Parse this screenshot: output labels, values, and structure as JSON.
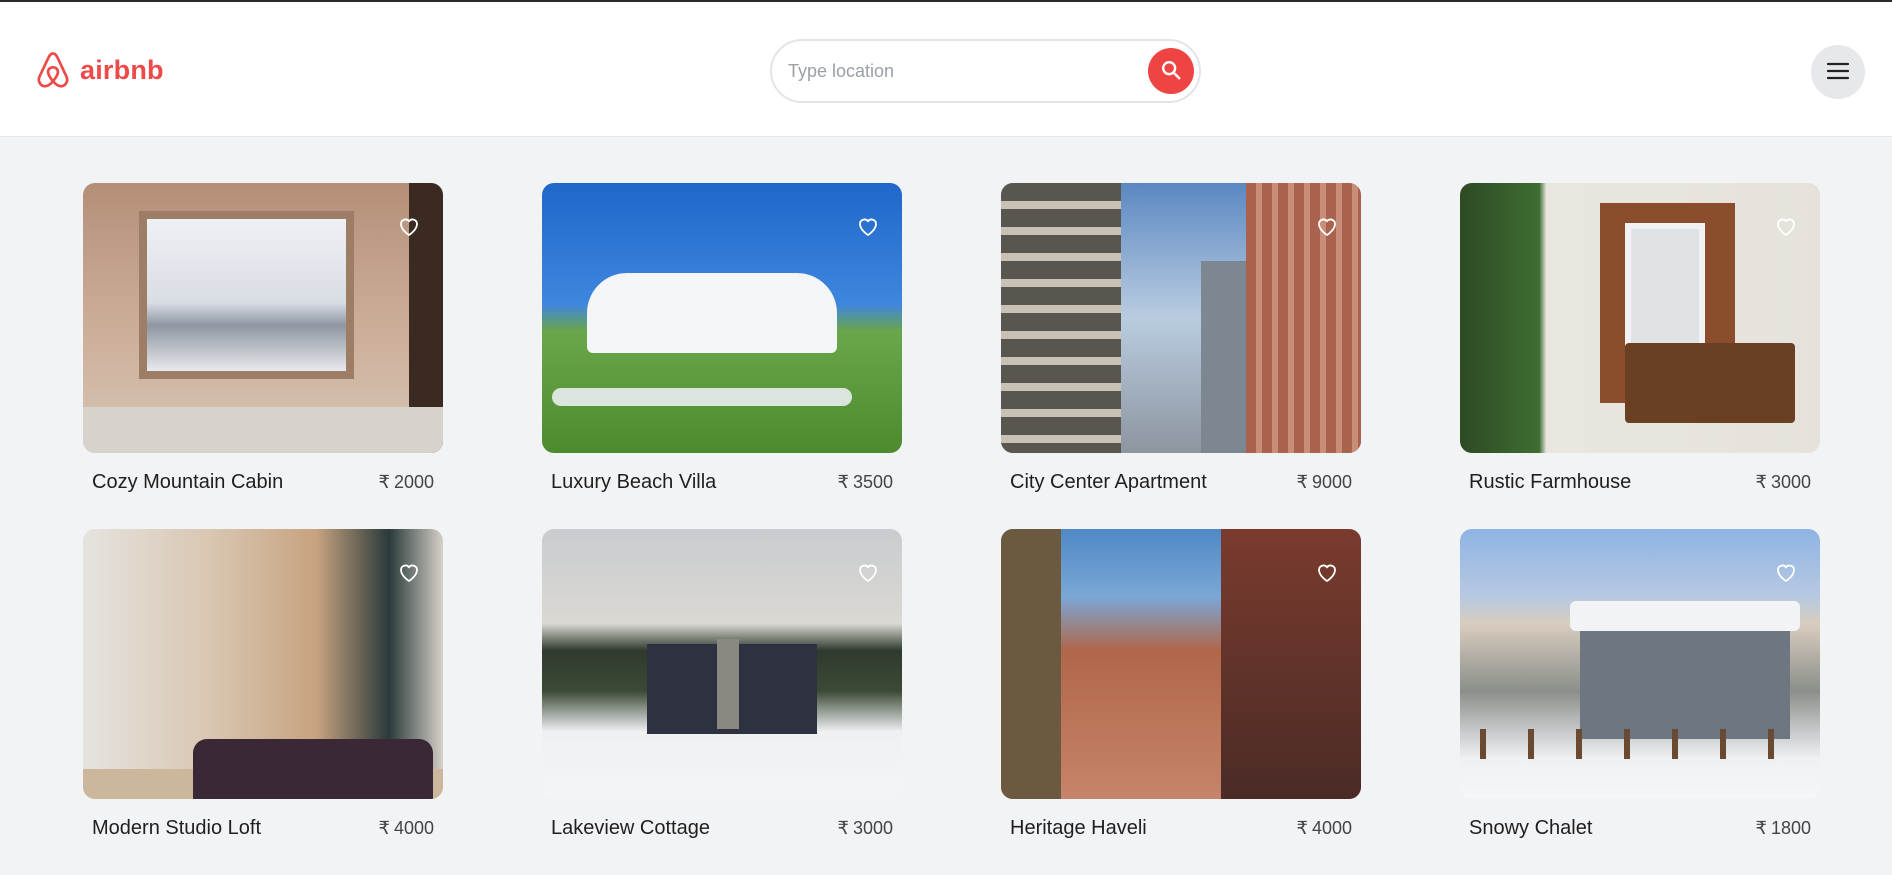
{
  "header": {
    "brand": "airbnb",
    "search": {
      "placeholder": "Type location",
      "value": ""
    },
    "icons": {
      "logo": "airbnb-logo-icon",
      "search": "search-icon",
      "menu": "menu-icon"
    }
  },
  "colors": {
    "brand": "#ef4a4a",
    "search_button": "#ef4444",
    "page_bg": "#f2f3f5"
  },
  "currency_symbol": "₹",
  "listings": [
    {
      "title": "Cozy Mountain Cabin",
      "price": "2000"
    },
    {
      "title": "Luxury Beach Villa",
      "price": "3500"
    },
    {
      "title": "City Center Apartment",
      "price": "9000"
    },
    {
      "title": "Rustic Farmhouse",
      "price": "3000"
    },
    {
      "title": "Modern Studio Loft",
      "price": "4000"
    },
    {
      "title": "Lakeview Cottage",
      "price": "3000"
    },
    {
      "title": "Heritage Haveli",
      "price": "4000"
    },
    {
      "title": "Snowy Chalet",
      "price": "1800"
    }
  ]
}
